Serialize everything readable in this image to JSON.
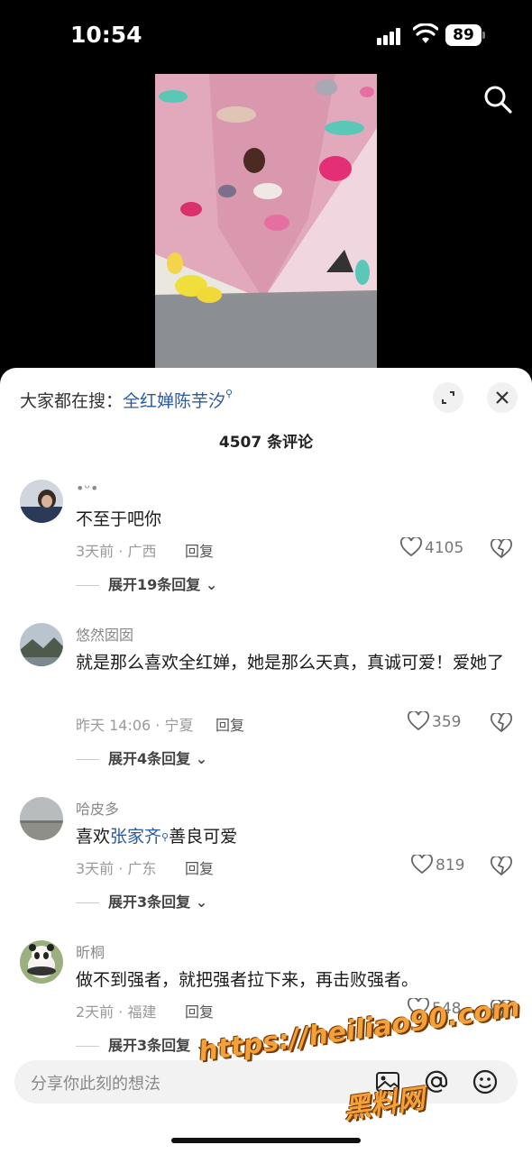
{
  "status_bar": {
    "time": "10:54",
    "battery": "89"
  },
  "search_hint": {
    "prefix": "大家都在搜：",
    "term": "全红婵陈芋汐"
  },
  "comment_count": "4507 条评论",
  "comments": [
    {
      "user": "•ᵕ•",
      "text": "不至于吧你",
      "meta": "3天前 · 广西",
      "reply": "回复",
      "likes": "4105",
      "more": "展开19条回复"
    },
    {
      "user": "悠然囡囡",
      "text": "就是那么喜欢全红婵，她是那么天真，真诚可爱！爱她了",
      "meta": "昨天 14:06 · 宁夏",
      "reply": "回复",
      "likes": "359",
      "more": "展开4条回复"
    },
    {
      "user": "哈皮多",
      "text_pre": "喜欢",
      "text_link": "张家齐",
      "text_post": "善良可爱",
      "meta": "3天前 · 广东",
      "reply": "回复",
      "likes": "819",
      "more": "展开3条回复"
    },
    {
      "user": "昕桐",
      "text": "做不到强者，就把强者拉下来，再击败强者。",
      "meta": "2天前 · 福建",
      "reply": "回复",
      "likes": "548",
      "more": "展开3条回复"
    }
  ],
  "input": {
    "placeholder": "分享你此刻的想法"
  },
  "watermark": {
    "line1": "https://heiliao90.com",
    "line2": "黑料网"
  },
  "colors": {
    "link": "#2c5aa0",
    "sheet_bg": "#ffffff",
    "watermark": "#f4a13a"
  },
  "icons": [
    "search-icon",
    "expand-icon",
    "close-icon",
    "heart-icon",
    "broken-heart-icon",
    "image-icon",
    "at-icon",
    "emoji-icon"
  ]
}
